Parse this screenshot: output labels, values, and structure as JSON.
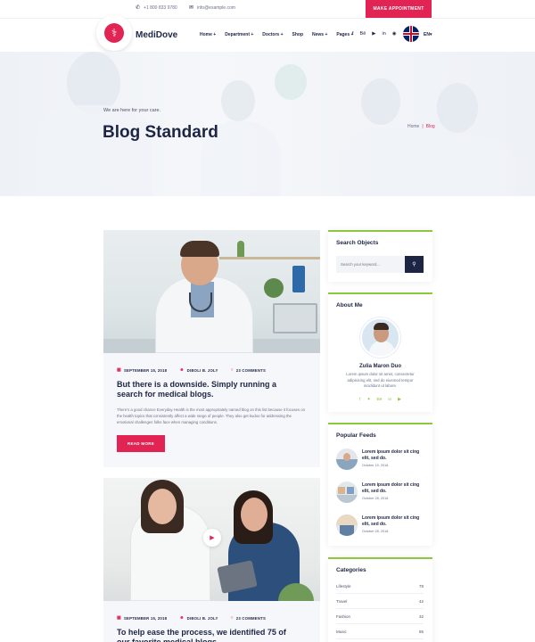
{
  "topbar": {
    "phone": "+1 800 833 9780",
    "email": "info@example.com",
    "appointment_button": "MAKE APPOINTMENT"
  },
  "header": {
    "brand": "MediDove",
    "nav": [
      "Home +",
      "Department +",
      "Doctors +",
      "Shop",
      "News +",
      "Pages +"
    ],
    "social_icons": [
      "facebook-icon",
      "behance-icon",
      "youtube-icon",
      "linkedin-icon",
      "dribbble-icon"
    ],
    "language": "EN",
    "accent_color": "#e12454",
    "dark_color": "#1d2544",
    "green_color": "#8dc63f"
  },
  "hero": {
    "tagline": "We are here for your care.",
    "title": "Blog Standard",
    "breadcrumb_home": "Home",
    "breadcrumb_current": "Blog"
  },
  "posts": [
    {
      "date": "SEPTEMBER 15, 2018",
      "author": "DIBOLI B. JOLY",
      "comments": "23 COMMENTS",
      "title": "But there is a downside. Simply running a search for medical blogs.",
      "excerpt": "There's a good chance Everyday Health is the most appropriately named blog on this list because it focuses on the health topics that consistently affect a wide range of people. They also get kudos for addressing the emotional challenges folks face when managing conditions.",
      "button": "READ MORE"
    },
    {
      "date": "SEPTEMBER 15, 2018",
      "author": "DIBOLI B. JOLY",
      "comments": "23 COMMENTS",
      "title": "To help ease the process, we identified 75 of our favorite medical blogs."
    }
  ],
  "sidebar": {
    "search": {
      "title": "Search Objects",
      "placeholder": "Search your keyword..."
    },
    "about": {
      "title": "About Me",
      "name": "Zulia Maron Duo",
      "text": "Lorem ipsum dolor sit amet, consectetur adipisicing elit, sed do eiusmod tempor incididunt ut labore."
    },
    "feeds": {
      "title": "Popular Feeds",
      "items": [
        {
          "title": "Lorem ipsum dolor sit cing elit, sed do.",
          "date": "October 19, 2018"
        },
        {
          "title": "Lorem ipsum dolor sit cing elit, sed do.",
          "date": "October 28, 2018"
        },
        {
          "title": "Lorem ipsum dolor sit cing elit, sed do.",
          "date": "October 28, 2018"
        }
      ]
    },
    "categories": {
      "title": "Categories",
      "items": [
        {
          "name": "Lifestyle",
          "count": "78"
        },
        {
          "name": "Travel",
          "count": "42"
        },
        {
          "name": "Fashion",
          "count": "32"
        },
        {
          "name": "Music",
          "count": "85"
        }
      ]
    }
  }
}
